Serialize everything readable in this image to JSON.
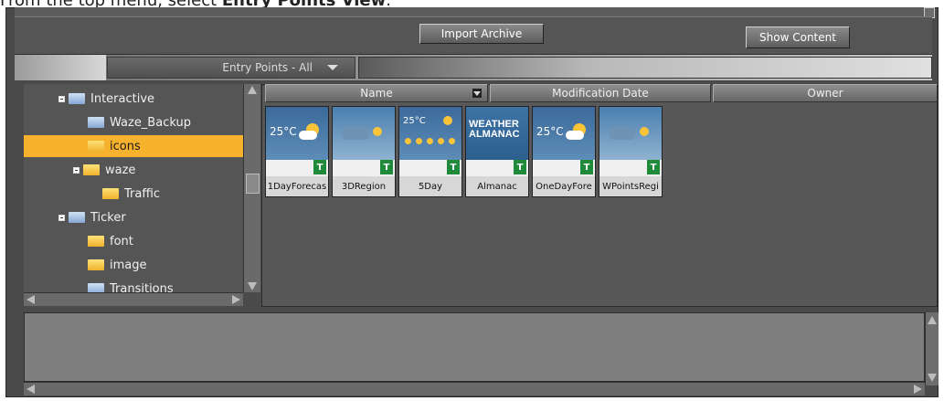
{
  "caption": {
    "prefix": "From the top menu, select ",
    "emphasis": "Entry Points View",
    "suffix": "."
  },
  "toolbar": {
    "import_label": "Import Archive",
    "show_content_label": "Show Content"
  },
  "filter": {
    "entry_points_label": "Entry Points - All"
  },
  "tree": {
    "items": [
      {
        "label": "Interactive",
        "icon": "folder-blue-icon",
        "expanded": true
      },
      {
        "label": "Waze_Backup",
        "icon": "folder-blue-icon"
      },
      {
        "label": "icons",
        "icon": "folder-yellow-icon",
        "selected": true
      },
      {
        "label": "waze",
        "icon": "folder-yellow-icon",
        "expanded": true
      },
      {
        "label": "Traffic",
        "icon": "folder-yellow-icon"
      },
      {
        "label": "Ticker",
        "icon": "folder-blue-icon",
        "expanded": true
      },
      {
        "label": "font",
        "icon": "folder-yellow-icon"
      },
      {
        "label": "image",
        "icon": "folder-yellow-icon"
      },
      {
        "label": "Transitions",
        "icon": "folder-blue-icon"
      }
    ]
  },
  "columns": {
    "name": "Name",
    "modification_date": "Modification Date",
    "owner": "Owner"
  },
  "thumbnails": [
    {
      "label": "1DayForecas",
      "temp": "25°C",
      "badge": "T"
    },
    {
      "label": "3DRegion",
      "badge": "T"
    },
    {
      "label": "5Day",
      "temp": "25°C",
      "badge": "T"
    },
    {
      "label": "Almanac",
      "title": "WEATHER ALMANAC",
      "badge": "T"
    },
    {
      "label": "OneDayFore",
      "temp": "25°C",
      "badge": "T"
    },
    {
      "label": "WPointsRegi",
      "badge": "T"
    }
  ],
  "colors": {
    "selection": "#f7b22d",
    "panel": "#555555",
    "badge_green": "#1f8a3a"
  }
}
